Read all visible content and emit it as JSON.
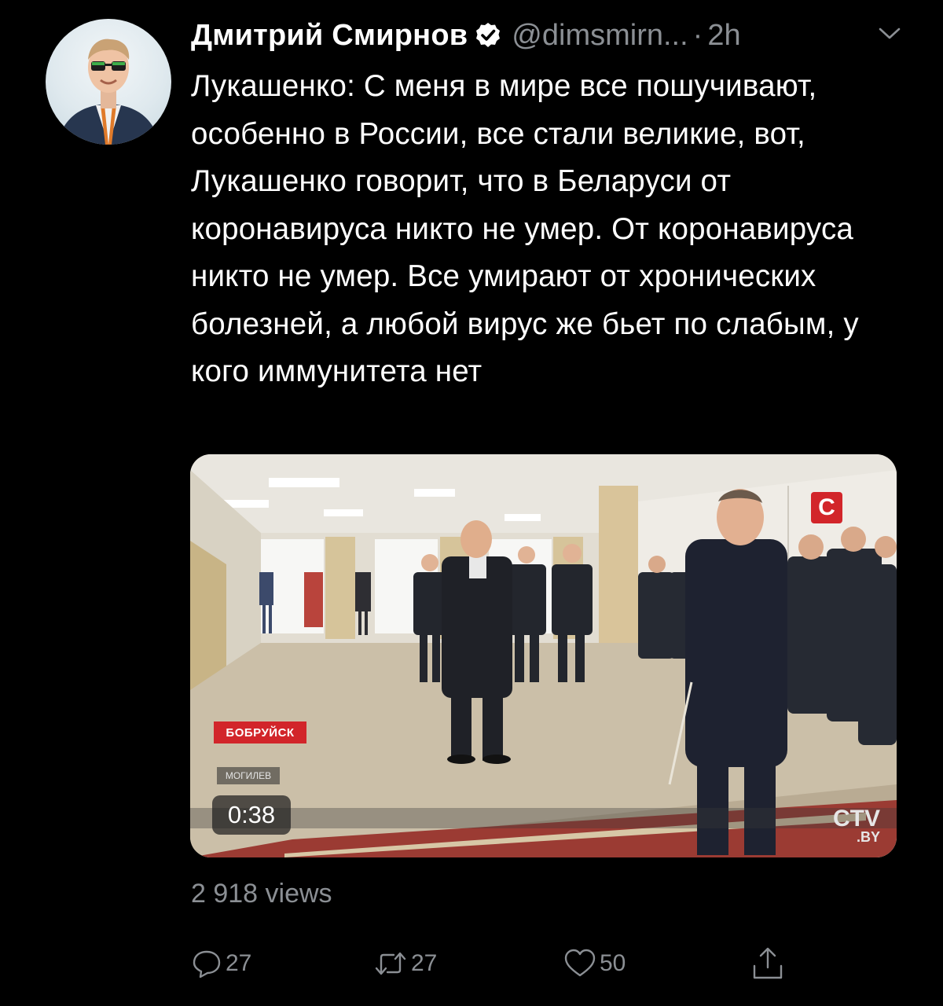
{
  "tweet": {
    "author": {
      "display_name": "Дмитрий Смирнов",
      "handle": "@dimsmirn...",
      "verified": true
    },
    "separator": "·",
    "time": "2h",
    "text": "Лукашенко: С меня в мире все пошучивают, особенно в России, все стали великие, вот, Лукашенко говорит, что в Беларуси от коронавируса никто не умер. От коронавируса никто не умер. Все умирают от хронических болезней, а любой вирус же бьет по слабым, у кого иммунитета нет",
    "video": {
      "duration": "0:38",
      "location_tag": "БОБРУЙСК",
      "region_tag": "МОГИЛЕВ",
      "channel_badge": "С",
      "channel_logo": "CTV",
      "channel_logo_sub": ".BY"
    },
    "views": "2 918 views",
    "actions": {
      "replies": "27",
      "retweets": "27",
      "likes": "50"
    }
  },
  "colors": {
    "background": "#000000",
    "primary_text": "#ffffff",
    "secondary_text": "#8b8f94",
    "verified_badge": "#ffffff",
    "news_red": "#d2252a"
  },
  "icons": {
    "menu": "chevron-down-icon",
    "verified": "verified-badge-icon",
    "reply": "reply-bubble-icon",
    "retweet": "retweet-icon",
    "like": "heart-icon",
    "share": "share-icon"
  }
}
